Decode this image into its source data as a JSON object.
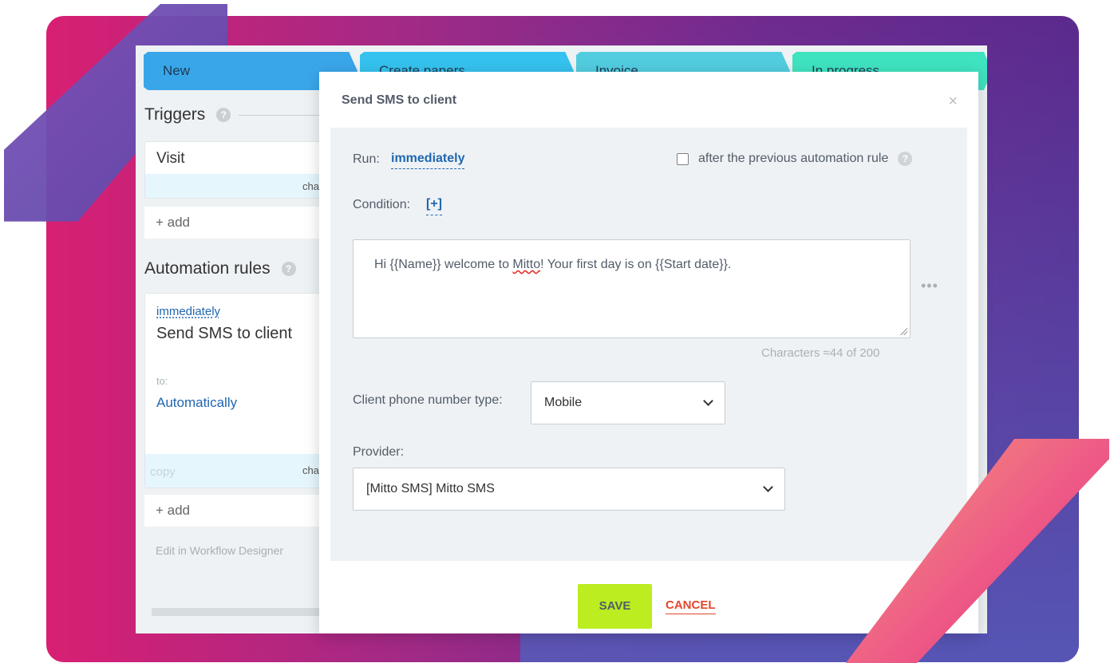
{
  "stages": [
    {
      "label": "New"
    },
    {
      "label": "Create papers"
    },
    {
      "label": "Invoice"
    },
    {
      "label": "In progress"
    }
  ],
  "sidebar": {
    "triggers_title": "Triggers",
    "trigger_name": "Visit",
    "trigger_foot": "cha",
    "add_label": "+ add",
    "automation_title": "Automation rules",
    "rule": {
      "when": "immediately",
      "name": "Send SMS to client",
      "to_label": "to:",
      "to_value": "Automatically",
      "copy_label": "copy",
      "foot": "cha"
    },
    "add_label_2": "+ add",
    "workflow_link": "Edit in Workflow Designer",
    "help_glyph": "?"
  },
  "modal": {
    "title": "Send SMS to client",
    "close_glyph": "×",
    "run_label": "Run:",
    "run_value": "immediately",
    "after_label": "after the previous automation rule",
    "after_checked": false,
    "condition_label": "Condition:",
    "condition_add": "[+]",
    "message": {
      "before": "Hi {{Name}} welcome to ",
      "misspelled": "Mitto",
      "after": "! Your first day is on {{Start date}}."
    },
    "more_glyph": "•••",
    "char_count": "Characters ≈44  of 200",
    "phone_type_label": "Client phone number type:",
    "phone_type_value": "Mobile",
    "provider_label": "Provider:",
    "provider_value": "[Mitto SMS] Mitto SMS",
    "save_label": "SAVE",
    "cancel_label": "CANCEL"
  },
  "colors": {
    "link": "#2067b0",
    "save": "#bbed21",
    "cancel": "#e2472b"
  },
  "icons": [
    "help-icon",
    "close-icon",
    "chevron-down-icon",
    "more-icon",
    "checkbox-icon"
  ]
}
